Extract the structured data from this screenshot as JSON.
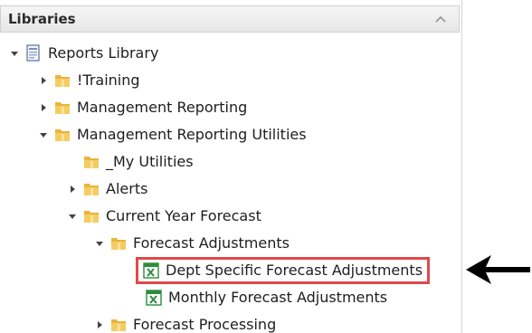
{
  "panel": {
    "title": "Libraries"
  },
  "tree": {
    "root": "Reports Library",
    "training": "!Training",
    "management_reporting": "Management Reporting",
    "management_reporting_utilities": "Management Reporting Utilities",
    "my_utilities": "_My Utilities",
    "alerts": "Alerts",
    "current_year_forecast": "Current Year Forecast",
    "forecast_adjustments": "Forecast Adjustments",
    "dept_specific_forecast_adjustments": "Dept Specific Forecast Adjustments",
    "monthly_forecast_adjustments": "Monthly Forecast Adjustments",
    "forecast_processing": "Forecast Processing"
  },
  "icons": {
    "expanded": "triangle-expanded-icon",
    "collapsed": "triangle-collapsed-icon",
    "folder": "folder-icon",
    "library": "report-library-icon",
    "report": "excel-report-icon",
    "pointer": "arrow-pointer-icon"
  },
  "colors": {
    "highlight_border": "#e04a4a",
    "folder": "#e8b53a",
    "excel_green": "#2e8b3a"
  }
}
